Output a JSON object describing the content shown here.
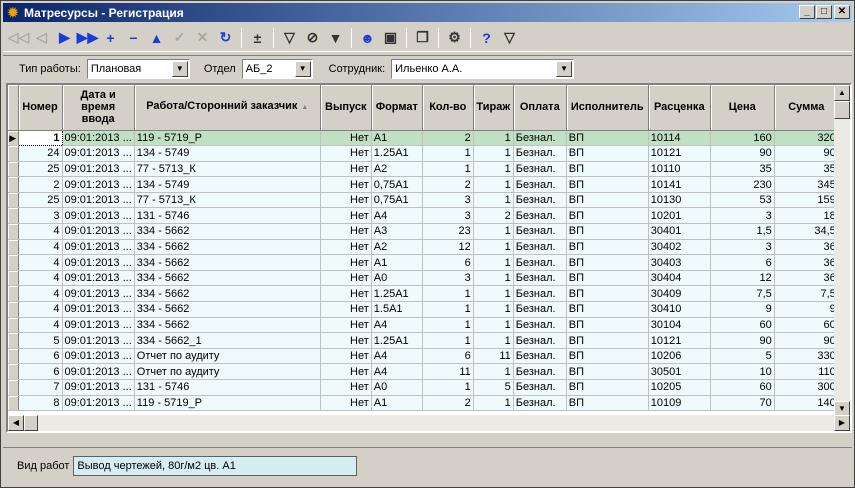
{
  "window": {
    "title": "Матресурсы - Регистрация",
    "app_icon": "gear-icon",
    "buttons": {
      "minimize": "_",
      "maximize": "□",
      "close": "✕"
    }
  },
  "toolbar": [
    {
      "name": "first-record-icon",
      "glyph": "◁◁",
      "style": "dis"
    },
    {
      "name": "prev-record-icon",
      "glyph": "◁",
      "style": "dis"
    },
    {
      "name": "next-record-icon",
      "glyph": "▶",
      "style": "blue"
    },
    {
      "name": "last-record-icon",
      "glyph": "▶▶",
      "style": "blue"
    },
    {
      "name": "add-record-icon",
      "glyph": "+",
      "style": "blue"
    },
    {
      "name": "delete-record-icon",
      "glyph": "−",
      "style": "blue"
    },
    {
      "name": "edit-record-icon",
      "glyph": "▲",
      "style": "blue"
    },
    {
      "name": "post-edit-icon",
      "glyph": "✓",
      "style": "dis"
    },
    {
      "name": "cancel-edit-icon",
      "glyph": "✕",
      "style": "dis"
    },
    {
      "name": "refresh-icon",
      "glyph": "↻",
      "style": "blue"
    },
    {
      "name": "sep"
    },
    {
      "name": "insert-row-icon",
      "glyph": "±",
      "style": "dark"
    },
    {
      "name": "sep"
    },
    {
      "name": "filter-icon",
      "glyph": "▽",
      "style": "dark"
    },
    {
      "name": "clear-filter-icon",
      "glyph": "⊘",
      "style": "dark"
    },
    {
      "name": "filter-edit-icon",
      "glyph": "▼",
      "style": "dark"
    },
    {
      "name": "sep"
    },
    {
      "name": "users-icon",
      "glyph": "☻",
      "style": "blue"
    },
    {
      "name": "report-icon",
      "glyph": "▣",
      "style": "dark"
    },
    {
      "name": "sep"
    },
    {
      "name": "copy-icon",
      "glyph": "❐",
      "style": "dark"
    },
    {
      "name": "sep"
    },
    {
      "name": "settings-icon",
      "glyph": "⚙",
      "style": "dark"
    },
    {
      "name": "sep"
    },
    {
      "name": "help-icon",
      "glyph": "?",
      "style": "blue"
    },
    {
      "name": "filter2-icon",
      "glyph": "▽",
      "style": "dark"
    }
  ],
  "filters": {
    "work_type": {
      "label": "Тип работы:",
      "value": "Плановая"
    },
    "department": {
      "label": "Отдел",
      "value": "АБ_2"
    },
    "employee": {
      "label": "Сотрудник:",
      "value": "Ильенко А.А."
    }
  },
  "table": {
    "columns": [
      "Номер",
      "Дата и время ввода",
      "Работа/Сторонний заказчик",
      "Выпуск",
      "Формат",
      "Кол-во",
      "Тираж",
      "Оплата",
      "Исполнитель",
      "Расценка",
      "Цена",
      "Сумма"
    ],
    "sort_indicator": "▲",
    "selected_row": 0,
    "rows": [
      [
        "1",
        "09:01:2013 ...",
        "119 - 5719_Р",
        "Нет",
        "А1",
        "2",
        "1",
        "Безнал.",
        "ВП",
        "10114",
        "160",
        "320"
      ],
      [
        "24",
        "09:01:2013 ...",
        "134 - 5749",
        "Нет",
        "1.25А1",
        "1",
        "1",
        "Безнал.",
        "ВП",
        "10121",
        "90",
        "90"
      ],
      [
        "25",
        "09:01:2013 ...",
        "77 - 5713_К",
        "Нет",
        "А2",
        "1",
        "1",
        "Безнал.",
        "ВП",
        "10110",
        "35",
        "35"
      ],
      [
        "2",
        "09:01:2013 ...",
        "134 - 5749",
        "Нет",
        "0,75А1",
        "2",
        "1",
        "Безнал.",
        "ВП",
        "10141",
        "230",
        "345"
      ],
      [
        "25",
        "09:01:2013 ...",
        "77 - 5713_К",
        "Нет",
        "0,75А1",
        "3",
        "1",
        "Безнал.",
        "ВП",
        "10130",
        "53",
        "159"
      ],
      [
        "3",
        "09:01:2013 ...",
        "131 - 5746",
        "Нет",
        "А4",
        "3",
        "2",
        "Безнал.",
        "ВП",
        "10201",
        "3",
        "18"
      ],
      [
        "4",
        "09:01:2013 ...",
        "334 - 5662",
        "Нет",
        "А3",
        "23",
        "1",
        "Безнал.",
        "ВП",
        "30401",
        "1,5",
        "34,5"
      ],
      [
        "4",
        "09:01:2013 ...",
        "334 - 5662",
        "Нет",
        "А2",
        "12",
        "1",
        "Безнал.",
        "ВП",
        "30402",
        "3",
        "36"
      ],
      [
        "4",
        "09:01:2013 ...",
        "334 - 5662",
        "Нет",
        "А1",
        "6",
        "1",
        "Безнал.",
        "ВП",
        "30403",
        "6",
        "36"
      ],
      [
        "4",
        "09:01:2013 ...",
        "334 - 5662",
        "Нет",
        "А0",
        "3",
        "1",
        "Безнал.",
        "ВП",
        "30404",
        "12",
        "36"
      ],
      [
        "4",
        "09:01:2013 ...",
        "334 - 5662",
        "Нет",
        "1.25А1",
        "1",
        "1",
        "Безнал.",
        "ВП",
        "30409",
        "7,5",
        "7,5"
      ],
      [
        "4",
        "09:01:2013 ...",
        "334 - 5662",
        "Нет",
        "1.5А1",
        "1",
        "1",
        "Безнал.",
        "ВП",
        "30410",
        "9",
        "9"
      ],
      [
        "4",
        "09:01:2013 ...",
        "334 - 5662",
        "Нет",
        "А4",
        "1",
        "1",
        "Безнал.",
        "ВП",
        "30104",
        "60",
        "60"
      ],
      [
        "5",
        "09:01:2013 ...",
        "334 - 5662_1",
        "Нет",
        "1.25А1",
        "1",
        "1",
        "Безнал.",
        "ВП",
        "10121",
        "90",
        "90"
      ],
      [
        "6",
        "09:01:2013 ...",
        "Отчет по аудиту",
        "Нет",
        "А4",
        "6",
        "11",
        "Безнал.",
        "ВП",
        "10206",
        "5",
        "330"
      ],
      [
        "6",
        "09:01:2013 ...",
        "Отчет по аудиту",
        "Нет",
        "А4",
        "11",
        "1",
        "Безнал.",
        "ВП",
        "30501",
        "10",
        "110"
      ],
      [
        "7",
        "09:01:2013 ...",
        "131 - 5746",
        "Нет",
        "А0",
        "1",
        "5",
        "Безнал.",
        "ВП",
        "10205",
        "60",
        "300"
      ],
      [
        "8",
        "09:01:2013 ...",
        "119 - 5719_Р",
        "Нет",
        "А1",
        "2",
        "1",
        "Безнал.",
        "ВП",
        "10109",
        "70",
        "140"
      ]
    ]
  },
  "status": {
    "label": "Вид работ",
    "value": "Вывод чертежей, 80г/м2 цв. А1"
  }
}
